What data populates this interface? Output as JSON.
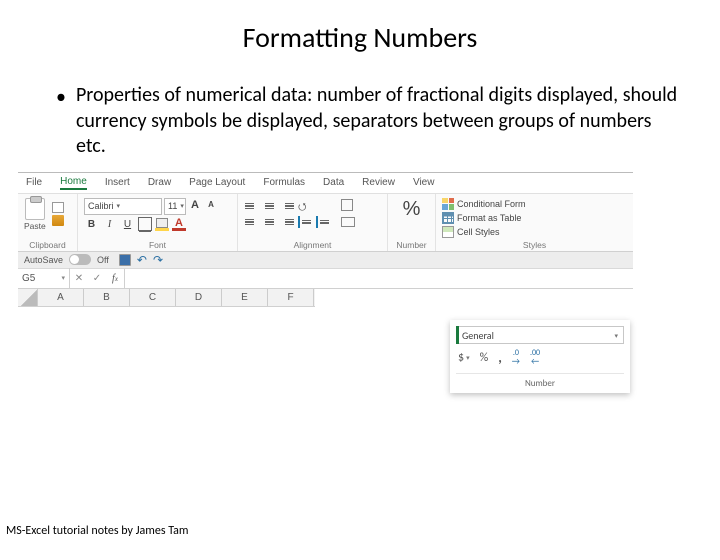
{
  "slide": {
    "title": "Formatting Numbers",
    "bullet": "Properties of numerical data: number of fractional digits displayed, should currency symbols be displayed, separators between groups of numbers etc.",
    "footer": "MS-Excel tutorial notes by James Tam"
  },
  "excel": {
    "tabs": [
      "File",
      "Home",
      "Insert",
      "Draw",
      "Page Layout",
      "Formulas",
      "Data",
      "Review",
      "View"
    ],
    "active_tab_index": 1,
    "groups": {
      "clipboard_label": "Clipboard",
      "paste_label": "Paste",
      "font_label": "Font",
      "alignment_label": "Alignment",
      "number_label": "Number",
      "styles_label": "Styles"
    },
    "font": {
      "name": "Calibri",
      "size": "11"
    },
    "styles": {
      "conditional": "Conditional Form",
      "table": "Format as Table",
      "cell": "Cell Styles"
    },
    "autosave": {
      "label": "AutoSave",
      "state": "Off"
    },
    "namebox": "G5",
    "columns": [
      "A",
      "B",
      "C",
      "D",
      "E",
      "F"
    ],
    "number_popout": {
      "selected": "General",
      "currency": "$",
      "percent": "%",
      "comma": ",",
      "label": "Number"
    }
  }
}
